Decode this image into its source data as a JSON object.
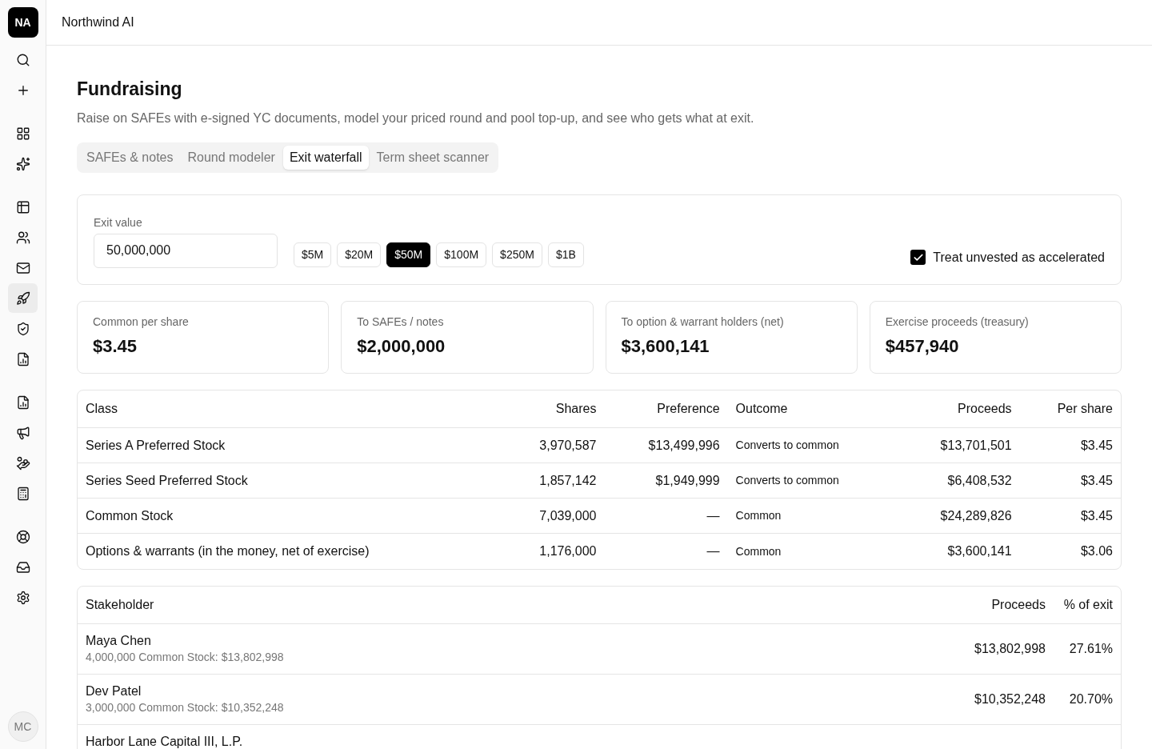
{
  "sidebar": {
    "avatar": "NA",
    "nav_groups": [
      [
        {
          "selected": false
        },
        {
          "selected": false
        }
      ],
      [
        {
          "selected": false
        },
        {
          "selected": false
        }
      ],
      [
        {
          "selected": false
        },
        {
          "selected": false
        },
        {
          "selected": false
        },
        {
          "selected": true
        },
        {
          "selected": false
        },
        {
          "selected": false
        }
      ],
      [
        {
          "selected": false
        },
        {
          "selected": false
        },
        {
          "selected": false
        },
        {
          "selected": false
        }
      ],
      [
        {
          "selected": false
        },
        {
          "selected": false
        },
        {
          "selected": false
        }
      ]
    ],
    "user": "MC"
  },
  "header": {
    "title": "Northwind AI"
  },
  "page": {
    "title": "Fundraising",
    "subtitle": "Raise on SAFEs with e-signed YC documents, model your priced round and pool top-up, and see who gets what at exit."
  },
  "tabs": [
    {
      "label": "SAFEs & notes",
      "selected": false
    },
    {
      "label": "Round modeler",
      "selected": false
    },
    {
      "label": "Exit waterfall",
      "selected": true
    },
    {
      "label": "Term sheet scanner",
      "selected": false
    }
  ],
  "exit": {
    "label": "Exit value",
    "value": "50,000,000",
    "presets": [
      {
        "label": "$5M",
        "selected": false
      },
      {
        "label": "$20M",
        "selected": false
      },
      {
        "label": "$50M",
        "selected": true
      },
      {
        "label": "$100M",
        "selected": false
      },
      {
        "label": "$250M",
        "selected": false
      },
      {
        "label": "$1B",
        "selected": false
      }
    ],
    "accelerate": {
      "label": "Treat unvested as accelerated",
      "checked": true
    }
  },
  "stats": [
    {
      "label": "Common per share",
      "value": "$3.45"
    },
    {
      "label": "To SAFEs / notes",
      "value": "$2,000,000"
    },
    {
      "label": "To option & warrant holders (net)",
      "value": "$3,600,141"
    },
    {
      "label": "Exercise proceeds (treasury)",
      "value": "$457,940"
    }
  ],
  "class_table": {
    "columns": [
      "Class",
      "Shares",
      "Preference",
      "Outcome",
      "Proceeds",
      "Per share"
    ],
    "rows": [
      [
        "Series A Preferred Stock",
        "3,970,587",
        "$13,499,996",
        "Converts to common",
        "$13,701,501",
        "$3.45"
      ],
      [
        "Series Seed Preferred Stock",
        "1,857,142",
        "$1,949,999",
        "Converts to common",
        "$6,408,532",
        "$3.45"
      ],
      [
        "Common Stock",
        "7,039,000",
        "—",
        "Common",
        "$24,289,826",
        "$3.45"
      ],
      [
        "Options & warrants (in the money, net of exercise)",
        "1,176,000",
        "—",
        "Common",
        "$3,600,141",
        "$3.06"
      ]
    ]
  },
  "stakeholder_table": {
    "columns": [
      "Stakeholder",
      "Proceeds",
      "% of exit"
    ],
    "rows": [
      {
        "name": "Maya Chen",
        "detail": "4,000,000 Common Stock: $13,802,998",
        "proceeds": "$13,802,998",
        "percent": "27.61%"
      },
      {
        "name": "Dev Patel",
        "detail": "3,000,000 Common Stock: $10,352,248",
        "proceeds": "$10,352,248",
        "percent": "20.70%"
      },
      {
        "name": "Harbor Lane Capital III, L.P."
      }
    ]
  }
}
